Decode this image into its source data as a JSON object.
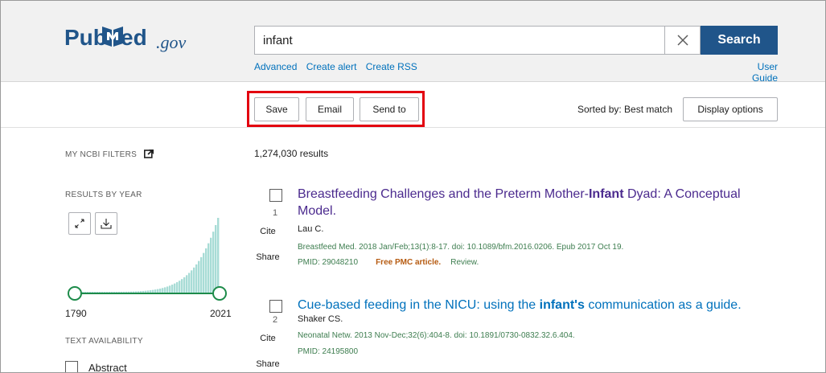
{
  "header": {
    "logo": {
      "pub": "Pub",
      "ed": "ed",
      "gov": ".gov"
    },
    "search": {
      "value": "infant",
      "button_label": "Search"
    },
    "links": [
      "Advanced",
      "Create alert",
      "Create RSS"
    ],
    "user_guide": "User Guide"
  },
  "actions": {
    "save": "Save",
    "email": "Email",
    "send_to": "Send to",
    "sorted_by": "Sorted by: Best match",
    "display_options": "Display options"
  },
  "sidebar": {
    "my_filters": "MY NCBI FILTERS",
    "results_by_year": "RESULTS BY YEAR",
    "year_start": "1790",
    "year_end": "2021",
    "year_range_selected": [
      "1790",
      "2021"
    ],
    "text_availability": "TEXT AVAILABILITY",
    "filters": [
      {
        "label": "Abstract",
        "checked": false
      }
    ]
  },
  "results": {
    "count": "1,274,030 results",
    "items": [
      {
        "num": "1",
        "title_before": "Breastfeeding Challenges and the Preterm Mother-",
        "title_highlight": "Infant",
        "title_after": " Dyad: A Conceptual Model.",
        "authors": "Lau C.",
        "citation": "Breastfeed Med. 2018 Jan/Feb;13(1):8-17. doi: 10.1089/bfm.2016.0206. Epub 2017 Oct 19.",
        "pmid": "PMID: 29048210",
        "free": "Free PMC article.",
        "review": "Review.",
        "cite": "Cite",
        "share": "Share"
      },
      {
        "num": "2",
        "title_before": "Cue-based feeding in the NICU: using the ",
        "title_highlight": "infant's",
        "title_after": " communication as a guide.",
        "authors": "Shaker CS.",
        "citation": "Neonatal Netw. 2013 Nov-Dec;32(6):404-8. doi: 10.1891/0730-0832.32.6.404.",
        "pmid": "PMID: 24195800",
        "cite": "Cite",
        "share": "Share"
      }
    ]
  },
  "colors": {
    "brand": "#20558a",
    "link": "#0071bc",
    "visited": "#4b2a8e",
    "citation": "#3d7d4f",
    "free_pmc": "#b65b11",
    "highlight_box": "#e3000f",
    "year_slider": "#1d8b4a"
  }
}
